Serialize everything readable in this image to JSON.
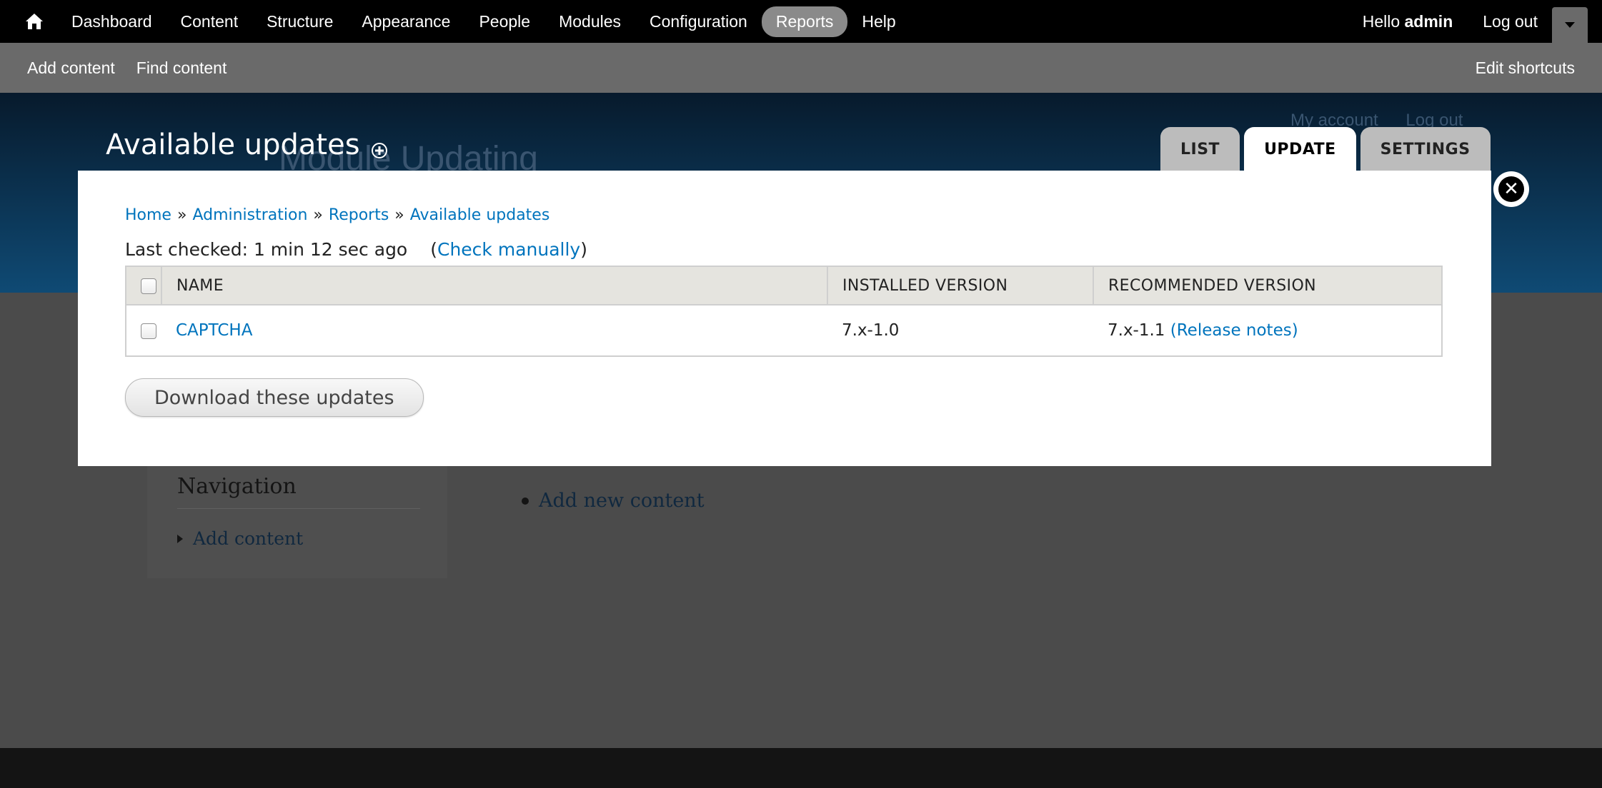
{
  "toolbar": {
    "menu": [
      "Dashboard",
      "Content",
      "Structure",
      "Appearance",
      "People",
      "Modules",
      "Configuration",
      "Reports",
      "Help"
    ],
    "active_item": "Reports",
    "hello_prefix": "Hello",
    "username": "admin",
    "logout": "Log out"
  },
  "shortcuts": {
    "items": [
      "Add content",
      "Find content"
    ],
    "edit": "Edit shortcuts"
  },
  "background": {
    "site_name": "Module Updating",
    "links": [
      "My account",
      "Log out"
    ],
    "sidebar_title": "Navigation",
    "sidebar_item": "Add content",
    "main_item": "Add new content"
  },
  "page": {
    "title": "Available updates",
    "tabs": [
      "LIST",
      "UPDATE",
      "SETTINGS"
    ],
    "active_tab": "UPDATE"
  },
  "overlay": {
    "breadcrumb": [
      "Home",
      "Administration",
      "Reports",
      "Available updates"
    ],
    "breadcrumb_sep": "»",
    "last_checked": "Last checked: 1 min 12 sec ago",
    "check_manually": "Check manually",
    "table": {
      "headers": [
        "NAME",
        "INSTALLED VERSION",
        "RECOMMENDED VERSION"
      ],
      "rows": [
        {
          "name": "CAPTCHA",
          "installed": "7.x-1.0",
          "recommended": "7.x-1.1",
          "notes": "(Release notes)"
        }
      ]
    },
    "download_button": "Download these updates"
  },
  "icons": {
    "home": "home-icon",
    "dropdown": "chevron-down-icon",
    "shortcut": "plus-circle-icon",
    "close": "close-icon"
  },
  "colors": {
    "link": "#0074bd",
    "toolbar": "#000000",
    "shortcut_bar": "#6a6a6a"
  }
}
